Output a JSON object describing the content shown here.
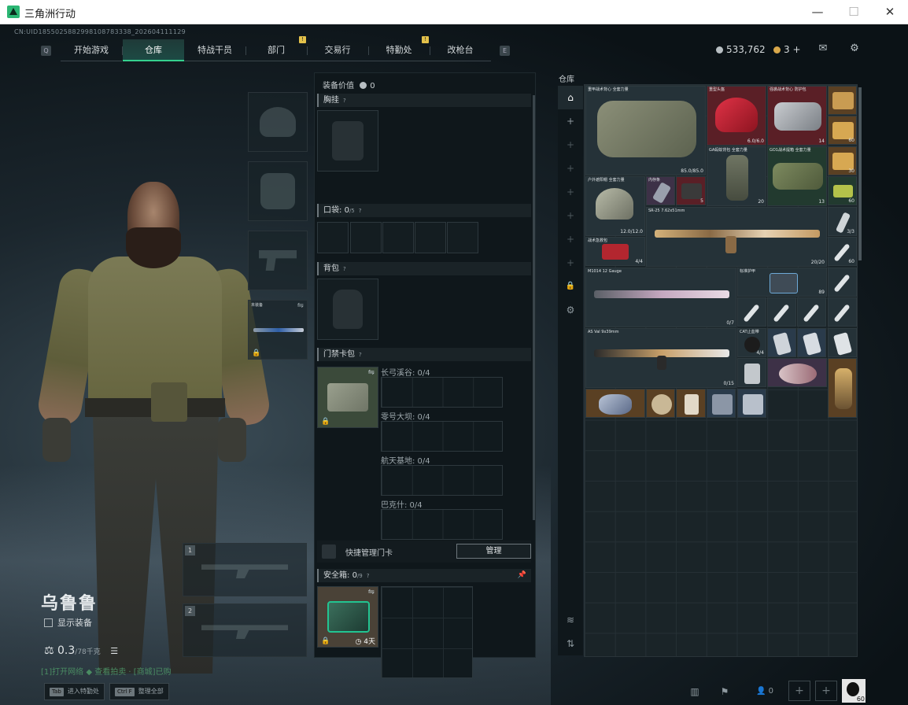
{
  "window": {
    "title": "三角洲行动"
  },
  "uid": "CN:UID1855025882998108783338_202604111129",
  "nav": {
    "left_key": "Q",
    "right_key": "E",
    "tabs": [
      {
        "label": "开始游戏"
      },
      {
        "label": "仓库"
      },
      {
        "label": "特战干员"
      },
      {
        "label": "部门"
      },
      {
        "label": "交易行"
      },
      {
        "label": "特勤处"
      },
      {
        "label": "改枪台"
      }
    ],
    "badge": "!"
  },
  "currency": {
    "silver": "533,762",
    "gold": "3",
    "gold_plus": "+"
  },
  "character": {
    "name": "乌鲁鲁",
    "show_equipment": "显示装备",
    "weight": "0.3",
    "weight_max": "/78千克",
    "hint": "[1]打开网络 ◆ 查看拍卖 · [商城]已购"
  },
  "left_slots": {
    "tool_label": "未装备",
    "weapon1": "1",
    "weapon2": "2"
  },
  "loadout": {
    "value_label": "装备价值",
    "value": "0",
    "chest_rig": "胸挂",
    "pocket_label": "口袋",
    "pocket_count": "0",
    "pocket_max": "/5",
    "backpack": "背包",
    "keycard_label": "门禁卡包",
    "keycards": [
      {
        "label": "长弓溪谷: 0/4"
      },
      {
        "label": "零号大坝: 0/4"
      },
      {
        "label": "航天基地: 0/4"
      },
      {
        "label": "巴克什: 0/4"
      }
    ],
    "quick_manage": "快捷管理门卡",
    "manage_btn": "管理",
    "safe_label": "安全箱",
    "safe_count": "0",
    "safe_max": "/9",
    "safe_time": "4天",
    "question": "?"
  },
  "warehouse": {
    "title": "仓库",
    "items": [
      {
        "name": "重甲战术背心 全套力量",
        "count": "85.0/85.0"
      },
      {
        "name": "重型头盔",
        "count": "6.0/6.0"
      },
      {
        "name": "强袭战术背心 防护包",
        "count": "14"
      },
      {
        "name": "GA蚂蚁背包 全套力量",
        "count": "20"
      },
      {
        "name": "GO1战术提箱 全套力量",
        "count": "13"
      },
      {
        "name": "户外遮阳帽 全套力量",
        "count": "12.0/12.0"
      },
      {
        "name": "内存条",
        "count": ""
      },
      {
        "name": "SR-25 7.62x51mm",
        "count": "20/20"
      },
      {
        "name": "战术急救包",
        "count": "4/4"
      },
      {
        "name": "M1014 12 Gauge",
        "count": "0/7"
      },
      {
        "name": "标准护甲",
        "count": "89"
      },
      {
        "name": "AS Val 9x39mm",
        "count": "0/15"
      },
      {
        "name": "CAT止血带",
        "count": "4/4"
      },
      {
        "name": "60",
        "count": "60"
      },
      {
        "name": "30",
        "count": "30"
      },
      {
        "name": "5",
        "count": "5"
      },
      {
        "name": "3/3",
        "count": "3/3"
      }
    ]
  },
  "bottom": {
    "key1": "Tab",
    "key1_label": "进入特勤处",
    "key2": "Ctrl F",
    "key2_label": "整理全部",
    "squad": "0",
    "avatar_level": "60"
  }
}
